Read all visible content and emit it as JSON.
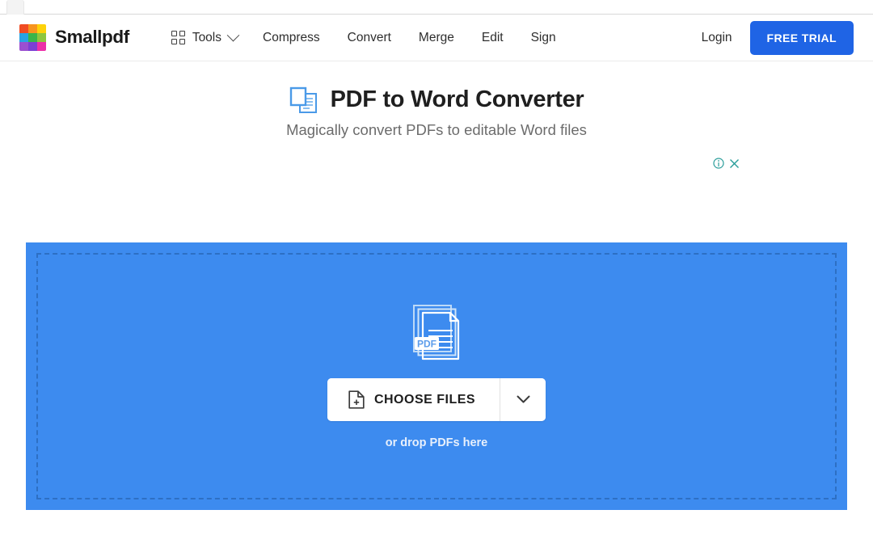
{
  "browser": {
    "tab_edge": "browser-tab-edge"
  },
  "header": {
    "brand_name": "Smallpdf",
    "logo_icon": "smallpdf-logo-grid",
    "logo_colors": [
      "#f04c23",
      "#f7941e",
      "#fdd20a",
      "#29a3e3",
      "#39b54a",
      "#8dc63f",
      "#9b4fd0",
      "#7b3fd4",
      "#ec2fa8"
    ],
    "tools": {
      "label": "Tools",
      "grid_icon": "grid-2x2-icon",
      "chevron_icon": "chevron-down-icon"
    },
    "nav_links": [
      {
        "label": "Compress"
      },
      {
        "label": "Convert"
      },
      {
        "label": "Merge"
      },
      {
        "label": "Edit"
      },
      {
        "label": "Sign"
      }
    ],
    "login_label": "Login",
    "cta_label": "FREE TRIAL",
    "cta_color": "#1f64e5"
  },
  "hero": {
    "icon": "pdf-to-word-icon",
    "icon_color": "#4a9ae8",
    "title": "PDF to Word Converter",
    "subtitle": "Magically convert PDFs to editable Word files"
  },
  "ad": {
    "info_icon": "ad-info-icon",
    "close_icon": "ad-close-icon",
    "control_color": "#2a9d9a"
  },
  "dropzone": {
    "background_color": "#3d8bef",
    "border_color": "#2d6fc4",
    "file_stack_icon": "pdf-file-stack-icon",
    "file_badge_label": "PDF",
    "choose_files_label": "CHOOSE FILES",
    "choose_files_icon": "file-plus-icon",
    "dropdown_icon": "chevron-down-icon",
    "drop_hint": "or drop PDFs here"
  }
}
